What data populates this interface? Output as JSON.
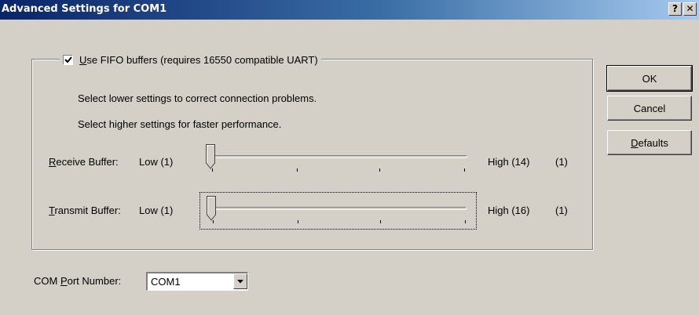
{
  "window": {
    "title": "Advanced Settings for COM1",
    "help_glyph": "?",
    "close_glyph": "✕"
  },
  "fifo": {
    "checked": true,
    "label_accel": "U",
    "label_rest": "se FIFO buffers (requires 16550 compatible UART)",
    "hint_lower": "Select lower settings to correct connection problems.",
    "hint_higher": "Select higher settings for faster performance."
  },
  "receive": {
    "label_accel": "R",
    "label_rest": "eceive Buffer:",
    "low": "Low (1)",
    "high": "High (14)",
    "value": "(1)",
    "position": 1,
    "min": 1,
    "max": 14
  },
  "transmit": {
    "label_accel": "T",
    "label_rest": "ransmit Buffer:",
    "low": "Low (1)",
    "high": "High (16)",
    "value": "(1)",
    "position": 1,
    "min": 1,
    "max": 16
  },
  "buttons": {
    "ok": "OK",
    "cancel": "Cancel",
    "defaults_accel": "D",
    "defaults_rest": "efaults"
  },
  "com_port": {
    "label_pre": "COM ",
    "label_accel": "P",
    "label_rest": "ort Number:",
    "value": "COM1"
  }
}
